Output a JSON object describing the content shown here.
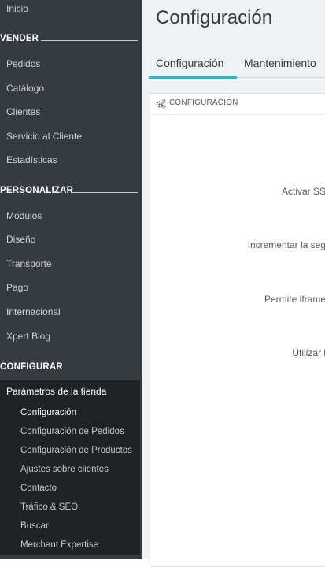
{
  "sidebar": {
    "top_items": [
      {
        "label": "Inicio"
      }
    ],
    "sections": [
      {
        "title": "VENDER",
        "items": [
          "Pedidos",
          "Catálogo",
          "Clientes",
          "Servicio al Cliente",
          "Estadísticas"
        ]
      },
      {
        "title": "PERSONALIZAR",
        "items": [
          "Módulos",
          "Diseño",
          "Transporte",
          "Pago",
          "Internacional",
          "Xpert Blog"
        ]
      },
      {
        "title": "CONFIGURAR",
        "items": []
      }
    ],
    "submenu": {
      "title": "Parámetros de la tienda",
      "items": [
        "Configuración",
        "Configuración de Pedidos",
        "Configuración de Productos",
        "Ajustes sobre clientes",
        "Contacto",
        "Tráfico & SEO",
        "Buscar",
        "Merchant Expertise"
      ],
      "active_index": 0
    }
  },
  "header": {
    "title": "Configuración"
  },
  "tabs": [
    {
      "label": "Configuración",
      "active": true
    },
    {
      "label": "Mantenimiento",
      "active": false
    }
  ],
  "panel": {
    "title": "CONFIGURACIÓN",
    "icon": "cogs-icon",
    "rows": [
      {
        "label": "Activar SS"
      },
      {
        "label": "Incrementar la seg"
      },
      {
        "label": "Permite iframe"
      },
      {
        "label": "Utilizar l"
      }
    ]
  },
  "colors": {
    "sidebar_bg": "#363a41",
    "submenu_bg": "#202226",
    "accent": "#25b9d7",
    "content_bg": "#eff1f2"
  }
}
